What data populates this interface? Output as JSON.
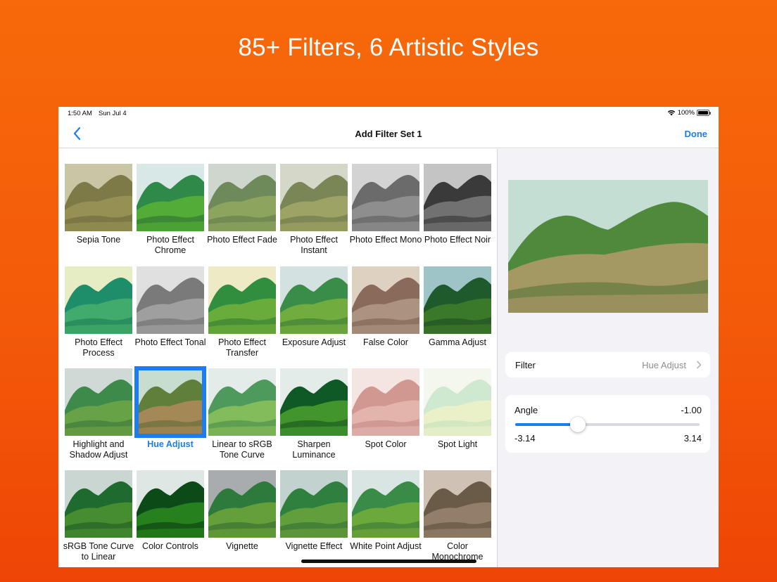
{
  "headline": "85+ Filters, 6 Artistic Styles",
  "status": {
    "time": "1:50 AM",
    "date": "Sun Jul 4",
    "battery": "100%",
    "wifi_icon": "wifi-icon",
    "battery_icon": "battery-icon"
  },
  "nav": {
    "title": "Add Filter Set 1",
    "done": "Done",
    "back_icon": "chevron-left-icon"
  },
  "filters": [
    {
      "label": "Sepia Tone",
      "sky": "#c9c6a6",
      "hill": "#7d7a48",
      "front": "#9a9457",
      "dark": "#5e5b33"
    },
    {
      "label": "Photo Effect Chrome",
      "sky": "#d8e8e6",
      "hill": "#2f8a4a",
      "front": "#59b134",
      "dark": "#1f5f33"
    },
    {
      "label": "Photo Effect Fade",
      "sky": "#cfd6cd",
      "hill": "#6f8a5a",
      "front": "#93a860",
      "dark": "#566a45"
    },
    {
      "label": "Photo Effect Instant",
      "sky": "#d5d8c9",
      "hill": "#7a8655",
      "front": "#a3a867",
      "dark": "#5c6540"
    },
    {
      "label": "Photo Effect Mono",
      "sky": "#d3d3d3",
      "hill": "#6b6b6b",
      "front": "#949494",
      "dark": "#4c4c4c"
    },
    {
      "label": "Photo Effect Noir",
      "sky": "#c4c4c4",
      "hill": "#3a3a3a",
      "front": "#7b7b7b",
      "dark": "#1e1e1e"
    },
    {
      "label": "Photo Effect Process",
      "sky": "#e6ecc3",
      "hill": "#1e8d6a",
      "front": "#47b06d",
      "dark": "#126b4e"
    },
    {
      "label": "Photo Effect Tonal",
      "sky": "#e0e0e0",
      "hill": "#7a7a7a",
      "front": "#a6a6a6",
      "dark": "#5b5b5b"
    },
    {
      "label": "Photo Effect Transfer",
      "sky": "#eeeac5",
      "hill": "#2f8f3e",
      "front": "#74b23b",
      "dark": "#1f6b2c"
    },
    {
      "label": "Exposure Adjust",
      "sky": "#d3e1e0",
      "hill": "#3a8d48",
      "front": "#7bb23d",
      "dark": "#2a6a35"
    },
    {
      "label": "False Color",
      "sky": "#dfd1c2",
      "hill": "#8a6a5a",
      "front": "#b09a86",
      "dark": "#6a4c40"
    },
    {
      "label": "Gamma Adjust",
      "sky": "#9fc4c8",
      "hill": "#1f5a2c",
      "front": "#3f7f2a",
      "dark": "#143f1f"
    },
    {
      "label": "Highlight and Shadow Adjust",
      "sky": "#cfdad6",
      "hill": "#3e8a4a",
      "front": "#6fa646",
      "dark": "#2a6535"
    },
    {
      "label": "Hue Adjust",
      "sky": "#c6ddd0",
      "hill": "#5f7f3a",
      "front": "#b08a5a",
      "dark": "#4a6230",
      "selected": true
    },
    {
      "label": "Linear to sRGB Tone Curve",
      "sky": "#e3ece9",
      "hill": "#4e9a5c",
      "front": "#8cc25a",
      "dark": "#377a46"
    },
    {
      "label": "Sharpen Luminance",
      "sky": "#e4ecea",
      "hill": "#0f5a24",
      "front": "#4aa02e",
      "dark": "#083f18"
    },
    {
      "label": "Spot Color",
      "sky": "#f4e4e2",
      "hill": "#d09890",
      "front": "#e6b8b2",
      "dark": "#b87870"
    },
    {
      "label": "Spot Light",
      "sky": "#f4f7ee",
      "hill": "#cfe8d0",
      "front": "#eef2c8",
      "dark": "#b9dcbc"
    },
    {
      "label": "sRGB Tone Curve to Linear",
      "sky": "#c9d6d2",
      "hill": "#1f6a2e",
      "front": "#4c9330",
      "dark": "#144a20"
    },
    {
      "label": "Color Controls",
      "sky": "#dfe7e4",
      "hill": "#0c4a18",
      "front": "#2a8a1e",
      "dark": "#02260a"
    },
    {
      "label": "Vignette",
      "sky": "#a8acae",
      "hill": "#2e7a3c",
      "front": "#6ea63a",
      "dark": "#245a2e"
    },
    {
      "label": "Vignette Effect",
      "sky": "#c2d2cf",
      "hill": "#2f7f3e",
      "front": "#6aa53c",
      "dark": "#245d30"
    },
    {
      "label": "White Point Adjust",
      "sky": "#d9e5e2",
      "hill": "#3a8a48",
      "front": "#76ae3c",
      "dark": "#2a6636"
    },
    {
      "label": "Color Monochrome",
      "sky": "#cfc2b4",
      "hill": "#6a5a48",
      "front": "#9a8670",
      "dark": "#4c3e30"
    }
  ],
  "preview": {
    "sky": "#c4ded4",
    "hill": "#4f8a3c",
    "front": "#b39a6a",
    "dark": "#3c6a2c"
  },
  "filter_row": {
    "label": "Filter",
    "value": "Hue Adjust",
    "chevron_icon": "chevron-right-icon"
  },
  "angle": {
    "label": "Angle",
    "value": "-1.00",
    "min": "-3.14",
    "max": "3.14",
    "min_num": -3.14,
    "max_num": 3.14,
    "current": -1.0
  },
  "accent": "#1c7cf2"
}
